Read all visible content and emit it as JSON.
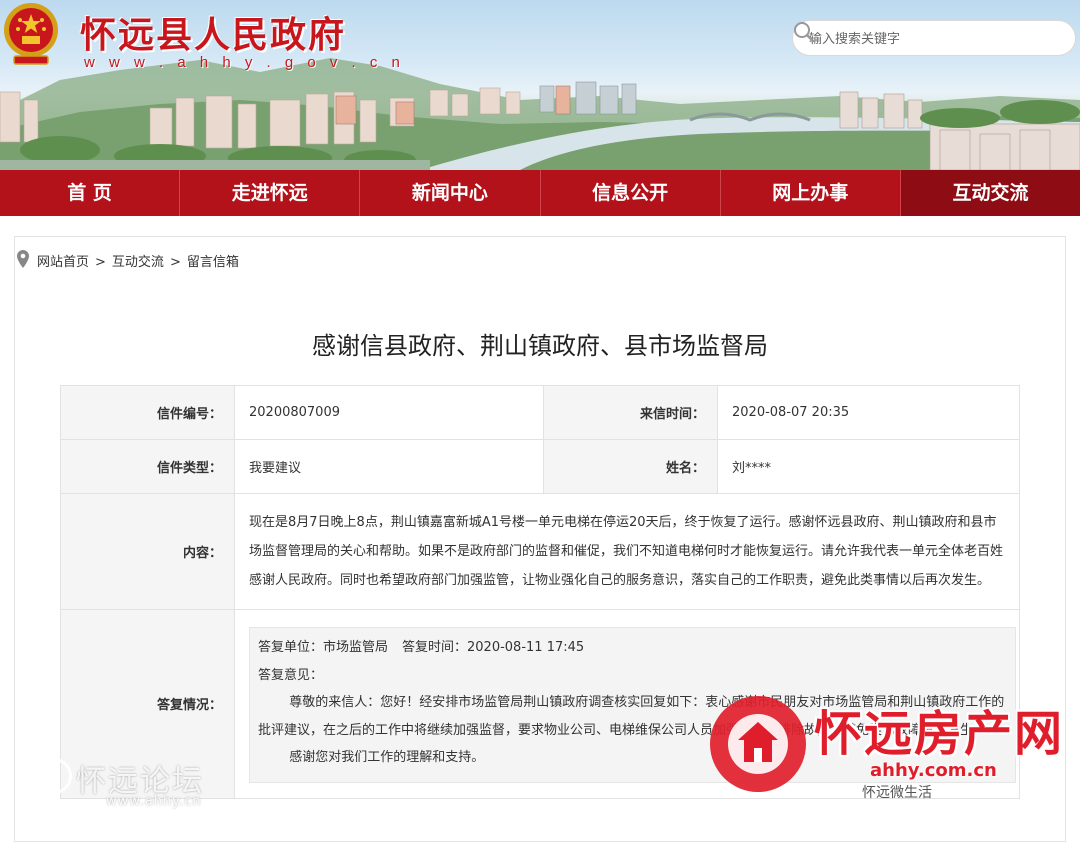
{
  "header": {
    "site_title": "怀远县人民政府",
    "site_url": "w w w . a h h y . g o v . c n",
    "search_placeholder": "输入搜索关键字"
  },
  "nav": {
    "items": [
      {
        "label": "首 页"
      },
      {
        "label": "走进怀远"
      },
      {
        "label": "新闻中心"
      },
      {
        "label": "信息公开"
      },
      {
        "label": "网上办事"
      },
      {
        "label": "互动交流"
      }
    ]
  },
  "breadcrumb": {
    "home": "网站首页",
    "section": "互动交流",
    "current": "留言信箱",
    "separator": ">"
  },
  "letter": {
    "title": "感谢信县政府、荆山镇政府、县市场监督局",
    "number_label": "信件编号：",
    "number": "20200807009",
    "time_label": "来信时间：",
    "time": "2020-08-07 20:35",
    "type_label": "信件类型：",
    "type": "我要建议",
    "name_label": "姓名：",
    "name": "刘****",
    "content_label": "内容：",
    "content": "现在是8月7日晚上8点，荆山镇嘉富新城A1号楼一单元电梯在停运20天后，终于恢复了运行。感谢怀远县政府、荆山镇政府和县市场监督管理局的关心和帮助。如果不是政府部门的监督和催促，我们不知道电梯何时才能恢复运行。请允许我代表一单元全体老百姓感谢人民政府。同时也希望政府部门加强监管，让物业强化自己的服务意识，落实自己的工作职责，避免此类事情以后再次发生。",
    "reply_label": "答复情况：",
    "reply": {
      "unit": "答复单位：市场监管局",
      "time": "答复时间：2020-08-11 17:45",
      "opinion_label": "答复意见：",
      "paragraph1": "尊敬的来信人：您好！经安排市场监管局荆山镇政府调查核实回复如下：衷心感谢市民朋友对市场监管局和荆山镇政府工作的批评建议，在之后的工作中将继续加强监督，要求物业公司、电梯维保公司人员加强维保，排除故障，避免类似故障再次发生。",
      "paragraph2": "感谢您对我们工作的理解和支持。"
    }
  },
  "watermarks": {
    "left_text": "怀远论坛",
    "left_url": "www.ahhy.cn",
    "right_brand": "怀远房产网",
    "right_url": "ahhy.com.cn",
    "right_wechat": "怀远微生活"
  },
  "colors": {
    "brand_red": "#c8161d",
    "nav_red": "#b3121b",
    "nav_active": "#8e0d14",
    "watermark_red": "#e01e2b"
  }
}
